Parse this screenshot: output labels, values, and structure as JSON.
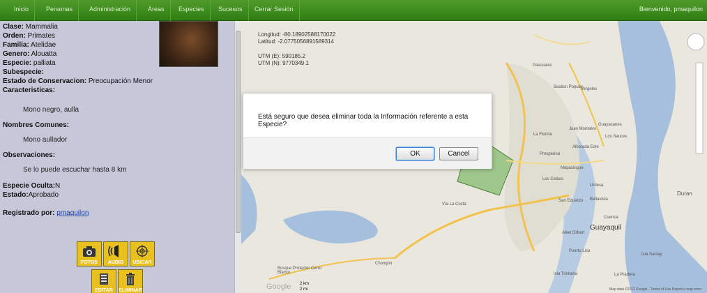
{
  "nav": {
    "items": [
      "Inicio",
      "Personas",
      "Administración",
      "Áreas",
      "Especies",
      "Sucesos",
      "Cerrar Sesión"
    ],
    "welcome": "Bienvenido, pmaquilon"
  },
  "species": {
    "clase_label": "Clase:",
    "clase": "Mammalia",
    "orden_label": "Orden:",
    "orden": "Primates",
    "familia_label": "Familia:",
    "familia": "Atelidae",
    "genero_label": "Genero:",
    "genero": "Alouatta",
    "especie_label": "Especie:",
    "especie": "palliata",
    "subespecie_label": "Subespecie:",
    "estado_cons_label": "Estado de Conservacion:",
    "estado_cons": "Preocupación Menor",
    "caracteristicas_label": "Caracteristicas:",
    "caracteristicas": "Mono negro, aulla",
    "nombres_label": "Nombres Comunes:",
    "nombres": "Mono aullador",
    "observaciones_label": "Observaciones:",
    "observaciones": "Se lo puede escuchar hasta 8 km",
    "oculta_label": "Especie Oculta:",
    "oculta": "N",
    "estado_label": "Estado:",
    "estado": "Aprobado",
    "registrado_label": "Registrado por:",
    "registrado": "pmaquilon"
  },
  "actions": {
    "fotos": "FOTOS",
    "audio": "AUDIO",
    "ubicar": "UBICAR",
    "editar": "EDITAR",
    "eliminar": "ELIMINAR"
  },
  "map": {
    "longitud": "Longitud: -80.18902588170022",
    "latitud": "Latitud: -2.0775056891589314",
    "utm_e": "UTM (E): 590185.2",
    "utm_n": "UTM (N): 9770349.1",
    "places": [
      "Pascuales",
      "Bastion Popular",
      "Vergeles",
      "Los Vergeles",
      "La Florida",
      "Juan Montalvo",
      "Los Sauces",
      "Guayacanes",
      "Alborada Este",
      "Prosperina",
      "Mapasingue",
      "Los Ceibos",
      "Urdesa",
      "Duran",
      "Vía La Costa",
      "San Eduardo",
      "Bellavista",
      "Cuenca",
      "Alkel Gilbert",
      "Guayaquil",
      "Puerto Lisa",
      "Isla Santay",
      "Isla Trinitaria",
      "La Pradera",
      "Chongón",
      "Bosque Protector Cerro Blanco"
    ],
    "scale_km": "2 km",
    "scale_mi": "2 mi",
    "google": "Google",
    "attribution": "Map data ©2012 Google - Terms of Use  Report a map error"
  },
  "dialog": {
    "message": "Está seguro que desea eliminar toda la Información referente a esta Especie?",
    "ok": "OK",
    "cancel": "Cancel"
  },
  "colors": {
    "nav": "#3f8c20",
    "panel": "#c6c8da",
    "dialog_ok_border": "#3c7fd6"
  }
}
